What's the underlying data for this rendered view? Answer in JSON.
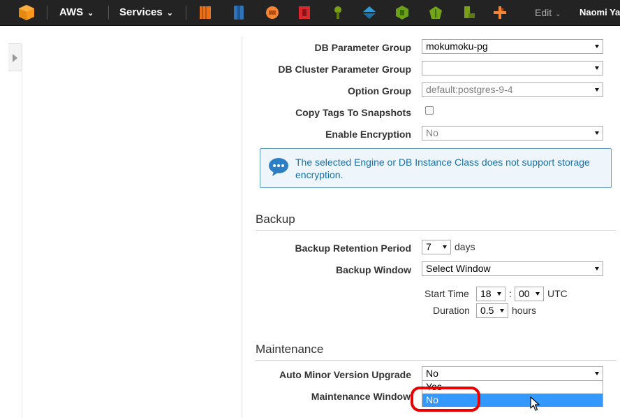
{
  "topbar": {
    "aws_label": "AWS",
    "services_label": "Services",
    "edit_label": "Edit",
    "user_label": "Naomi Yan",
    "service_icons": [
      "ec2-icon",
      "s3-icon",
      "cloudfront-icon",
      "iam-icon",
      "kms-icon",
      "directconnect-icon",
      "opsworks-icon",
      "elasticbeanstalk-icon",
      "cloudformation-icon",
      "lambda-icon"
    ]
  },
  "form": {
    "db_parameter_group": {
      "label": "DB Parameter Group",
      "value": "mokumoku-pg"
    },
    "db_cluster_parameter_group": {
      "label": "DB Cluster Parameter Group",
      "value": ""
    },
    "option_group": {
      "label": "Option Group",
      "value": "default:postgres-9-4"
    },
    "copy_tags": {
      "label": "Copy Tags To Snapshots"
    },
    "enable_encryption": {
      "label": "Enable Encryption",
      "value": "No"
    },
    "info_message": "The selected Engine or DB Instance Class does not support storage encryption."
  },
  "backup": {
    "title": "Backup",
    "retention_label": "Backup Retention Period",
    "retention_value": "7",
    "retention_unit": "days",
    "window_label": "Backup Window",
    "window_value": "Select Window",
    "start_time_label": "Start Time",
    "start_hour": "18",
    "time_sep": ":",
    "start_minute": "00",
    "utc_label": "UTC",
    "duration_label": "Duration",
    "duration_value": "0.5",
    "duration_unit": "hours"
  },
  "maintenance": {
    "title": "Maintenance",
    "auto_minor_label": "Auto Minor Version Upgrade",
    "auto_minor_value": "No",
    "window_label": "Maintenance Window",
    "options": [
      "Yes",
      "No"
    ],
    "selected_option": "No"
  }
}
